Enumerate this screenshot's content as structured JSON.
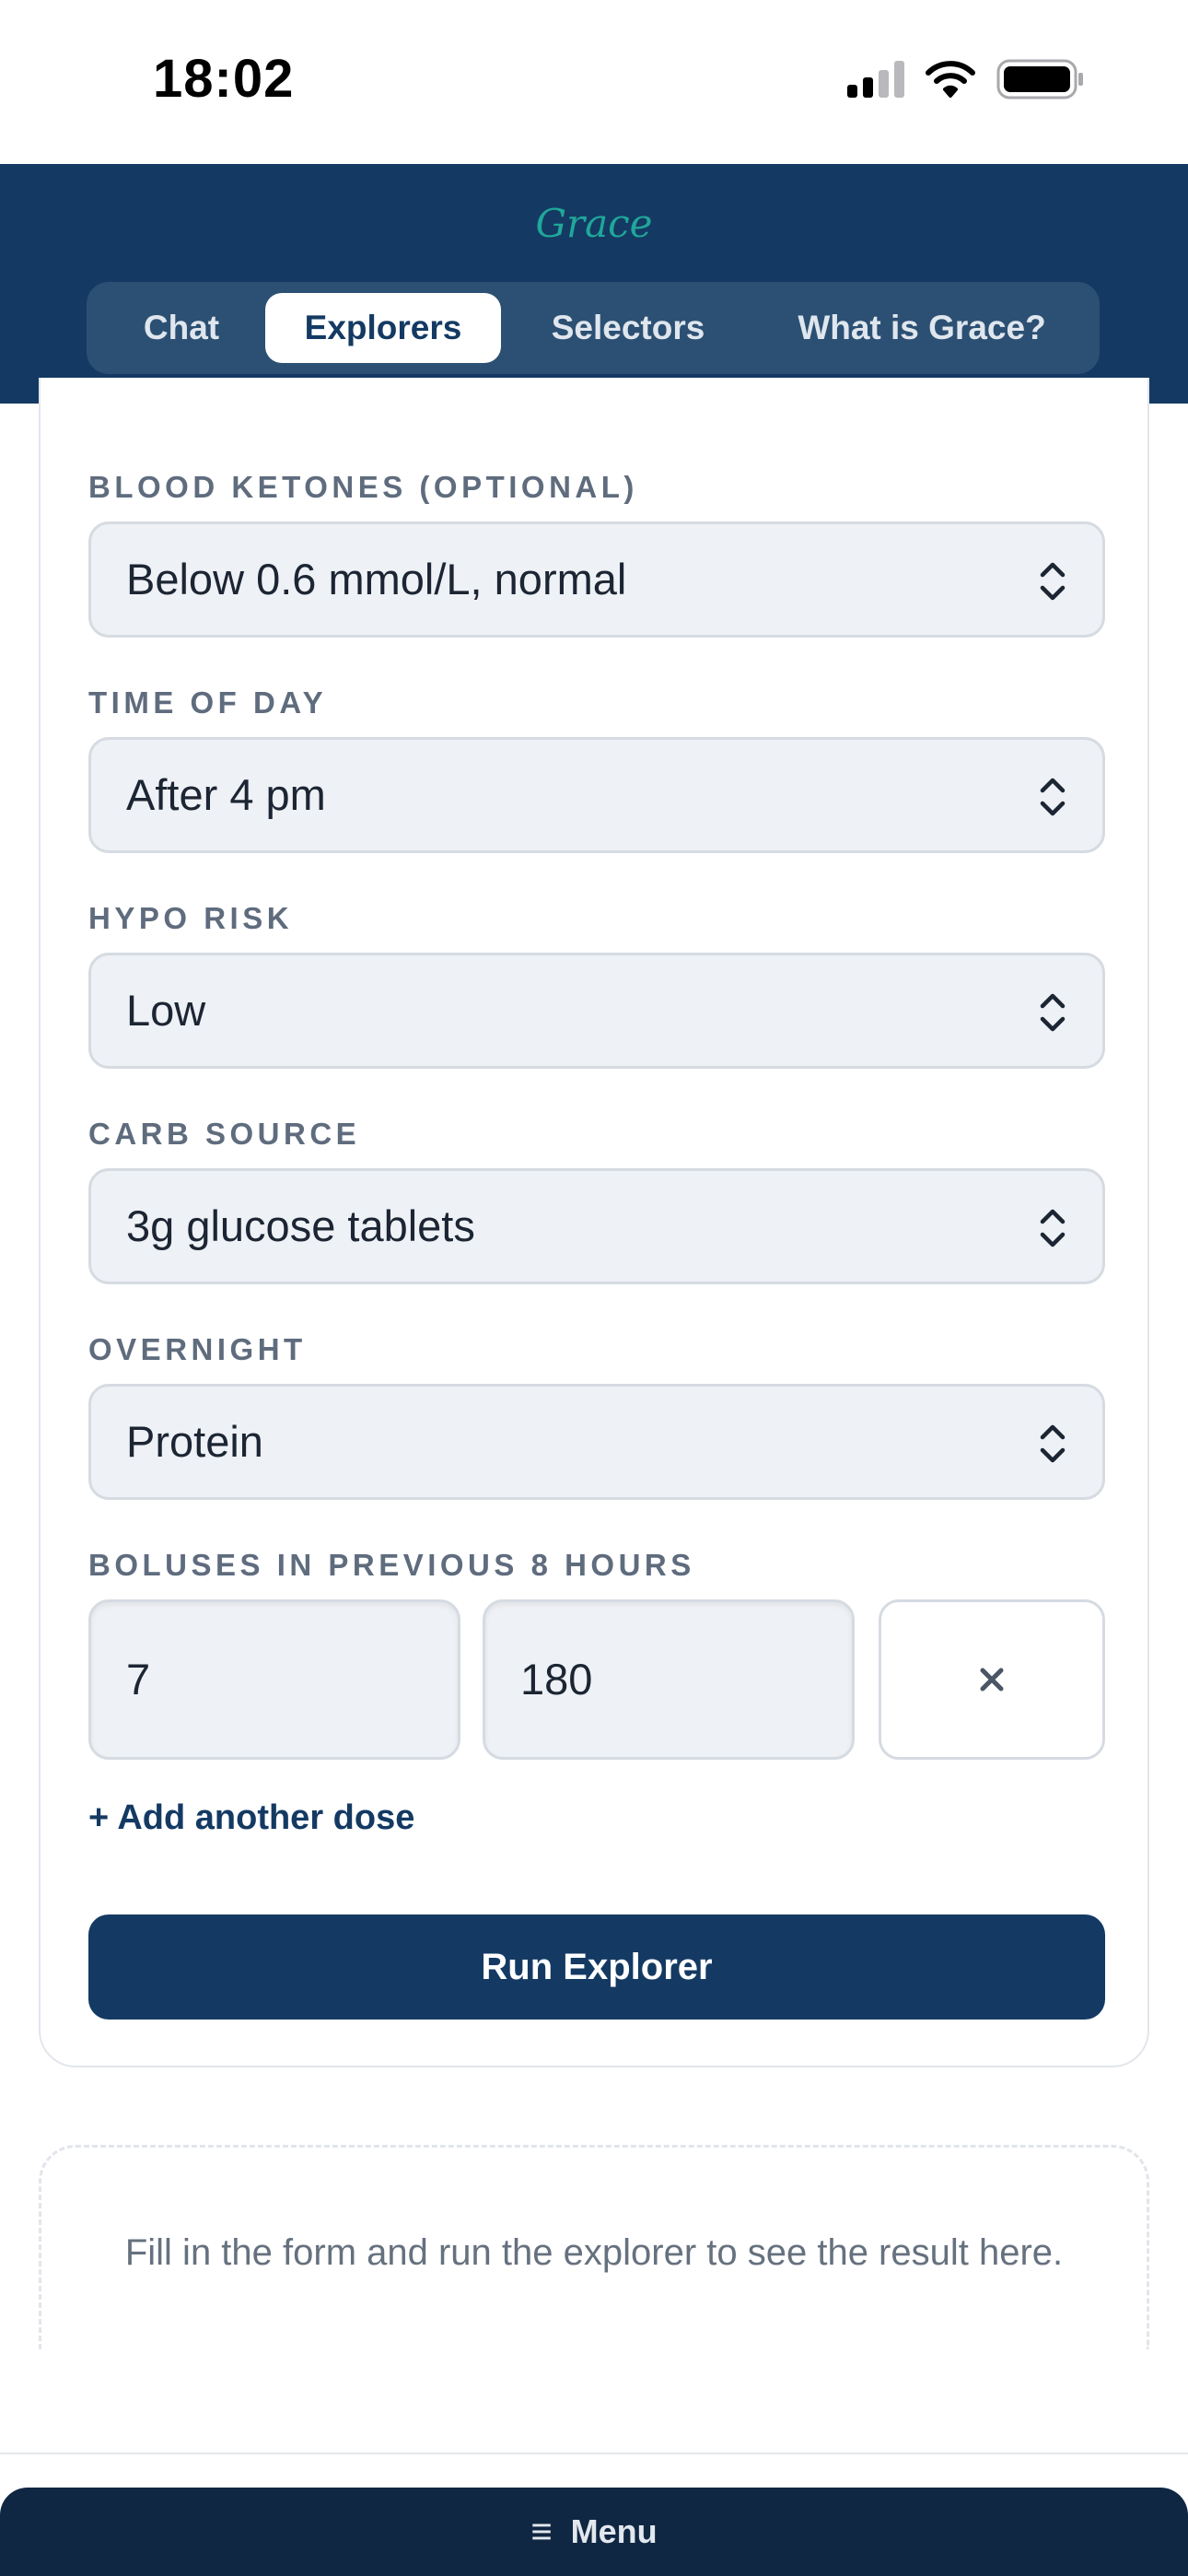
{
  "status_bar": {
    "time": "18:02"
  },
  "header": {
    "brand": "Grace",
    "tabs": [
      {
        "label": "Chat",
        "active": false
      },
      {
        "label": "Explorers",
        "active": true
      },
      {
        "label": "Selectors",
        "active": false
      },
      {
        "label": "What is Grace?",
        "active": false
      }
    ]
  },
  "form": {
    "fields": [
      {
        "label": "BLOOD KETONES (OPTIONAL)",
        "value": "Below 0.6 mmol/L, normal"
      },
      {
        "label": "TIME OF DAY",
        "value": "After 4 pm"
      },
      {
        "label": "HYPO RISK",
        "value": "Low"
      },
      {
        "label": "CARB SOURCE",
        "value": "3g glucose tablets"
      },
      {
        "label": "OVERNIGHT",
        "value": "Protein"
      }
    ],
    "boluses": {
      "label": "BOLUSES IN PREVIOUS 8 HOURS",
      "rows": [
        {
          "amount": "7",
          "minutes": "180"
        }
      ],
      "add_label": "+ Add another dose"
    },
    "run_label": "Run Explorer"
  },
  "result": {
    "placeholder": "Fill in the form and run the explorer to see the result here."
  },
  "footer": {
    "menu_label": "Menu"
  },
  "colors": {
    "navy": "#143a63",
    "teal": "#20a79a",
    "menu": "#0f2742"
  }
}
